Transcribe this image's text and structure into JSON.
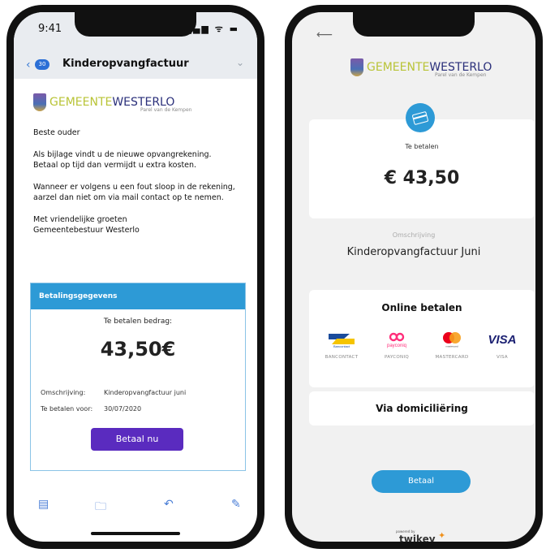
{
  "left_phone": {
    "status": {
      "time": "9:41",
      "icons": "▂▄▆ ᯤ ▬"
    },
    "header": {
      "back": "‹",
      "badge": "30",
      "subject": "Kinderopvangfactuur",
      "chevron": "⌄"
    },
    "logo": {
      "part1": "GEMEENTE",
      "part2": "WESTERLO",
      "tagline": "Parel van de Kempen"
    },
    "body": {
      "greeting": "Beste ouder",
      "p1_line1": "Als bijlage vindt u de nieuwe opvangrekening.",
      "p1_line2": "Betaal op tijd dan vermijdt u extra kosten.",
      "p2_line1": "Wanneer er volgens u een fout sloop in de rekening,",
      "p2_line2": "aarzel dan niet om via mail contact op te nemen.",
      "closing_line1": "Met vriendelijke groeten",
      "closing_line2": "Gemeentebestuur Westerlo"
    },
    "payment": {
      "header": "Betalingsgegevens",
      "amount_label": "Te betalen bedrag:",
      "amount": "43,50€",
      "desc_key": "Omschrijving:",
      "desc_value": "Kinderopvangfactuur juni",
      "due_key": "Te betalen voor:",
      "due_value": "30/07/2020",
      "button": "Betaal nu"
    },
    "toolbar": {
      "archive": "▤",
      "folder": "🗀",
      "reply": "↶",
      "compose": "✎"
    }
  },
  "right_phone": {
    "back": "⟵",
    "logo": {
      "part1": "GEMEENTE",
      "part2": "WESTERLO",
      "tagline": "Parel van de Kempen"
    },
    "pay_label": "Te betalen",
    "amount": "€ 43,50",
    "description_label": "Omschrijving",
    "description": "Kinderopvangfactuur Juni",
    "online_title": "Online betalen",
    "methods": [
      {
        "logo": "Bancontact",
        "name": "BANCONTACT"
      },
      {
        "logo": "payconiq",
        "name": "PAYCONIQ"
      },
      {
        "logo": "mastercard",
        "name": "MASTERCARD"
      },
      {
        "logo": "VISA",
        "name": "VISA"
      }
    ],
    "domiciliation": "Via domiciliëring",
    "button": "Betaal",
    "powered": "powered by",
    "brand": "twikey"
  },
  "colors": {
    "accent": "#2d9ad6",
    "pay_button": "#5a2bbf",
    "logo_green": "#b9c437",
    "logo_navy": "#2a2f7a"
  }
}
